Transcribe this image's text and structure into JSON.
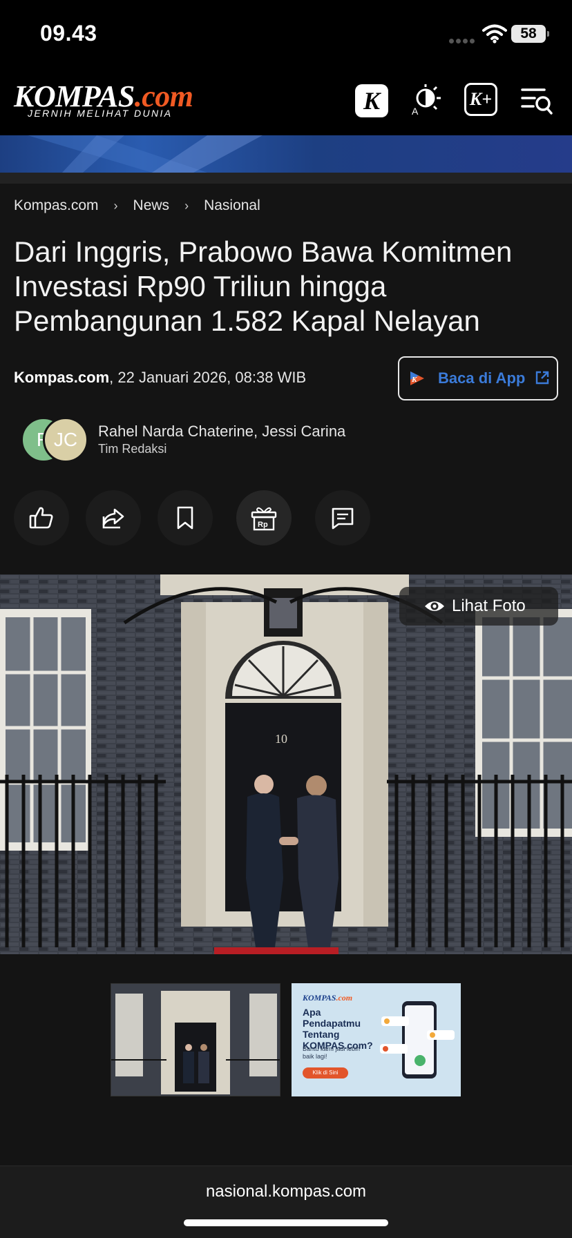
{
  "status_bar": {
    "time": "09.43",
    "battery": "58"
  },
  "header": {
    "logo_text": "KOMPAS",
    "logo_suffix": ".com",
    "tagline": "JERNIH MELIHAT DUNIA",
    "k_button_label": "K",
    "kplus_label": "K+"
  },
  "breadcrumb": [
    "Kompas.com",
    "News",
    "Nasional"
  ],
  "breadcrumb_separator": "›",
  "article": {
    "headline": "Dari Inggris, Prabowo Bawa Komitmen Investasi Rp90 Triliun hingga Pembangunan 1.582 Kapal Nelayan",
    "source": "Kompas.com",
    "date": ", 22 Januari 2026, 08:38 WIB",
    "app_button_label": "Baca di App",
    "authors": "Rahel Narda Chaterine,  Jessi Carina",
    "team": "Tim Redaksi",
    "avatar_1_initial": "R",
    "avatar_2_initials": "JC"
  },
  "actions": {
    "gift_label": "Rp"
  },
  "photo": {
    "view_label": "Lihat Foto",
    "door_number": "10"
  },
  "ad": {
    "brand": "KOMPAS",
    "brand_suffix": ".com",
    "title": "Apa Pendapatmu Tentang KOMPAS.com?",
    "subtitle": "Bantu kami jadi lebih baik lagi!",
    "cta": "Klik di Sini"
  },
  "url_bar": {
    "domain": "nasional.kompas.com"
  },
  "colors": {
    "brand_orange": "#f15a23",
    "link_blue": "#3b7bd9",
    "background": "#141414"
  }
}
